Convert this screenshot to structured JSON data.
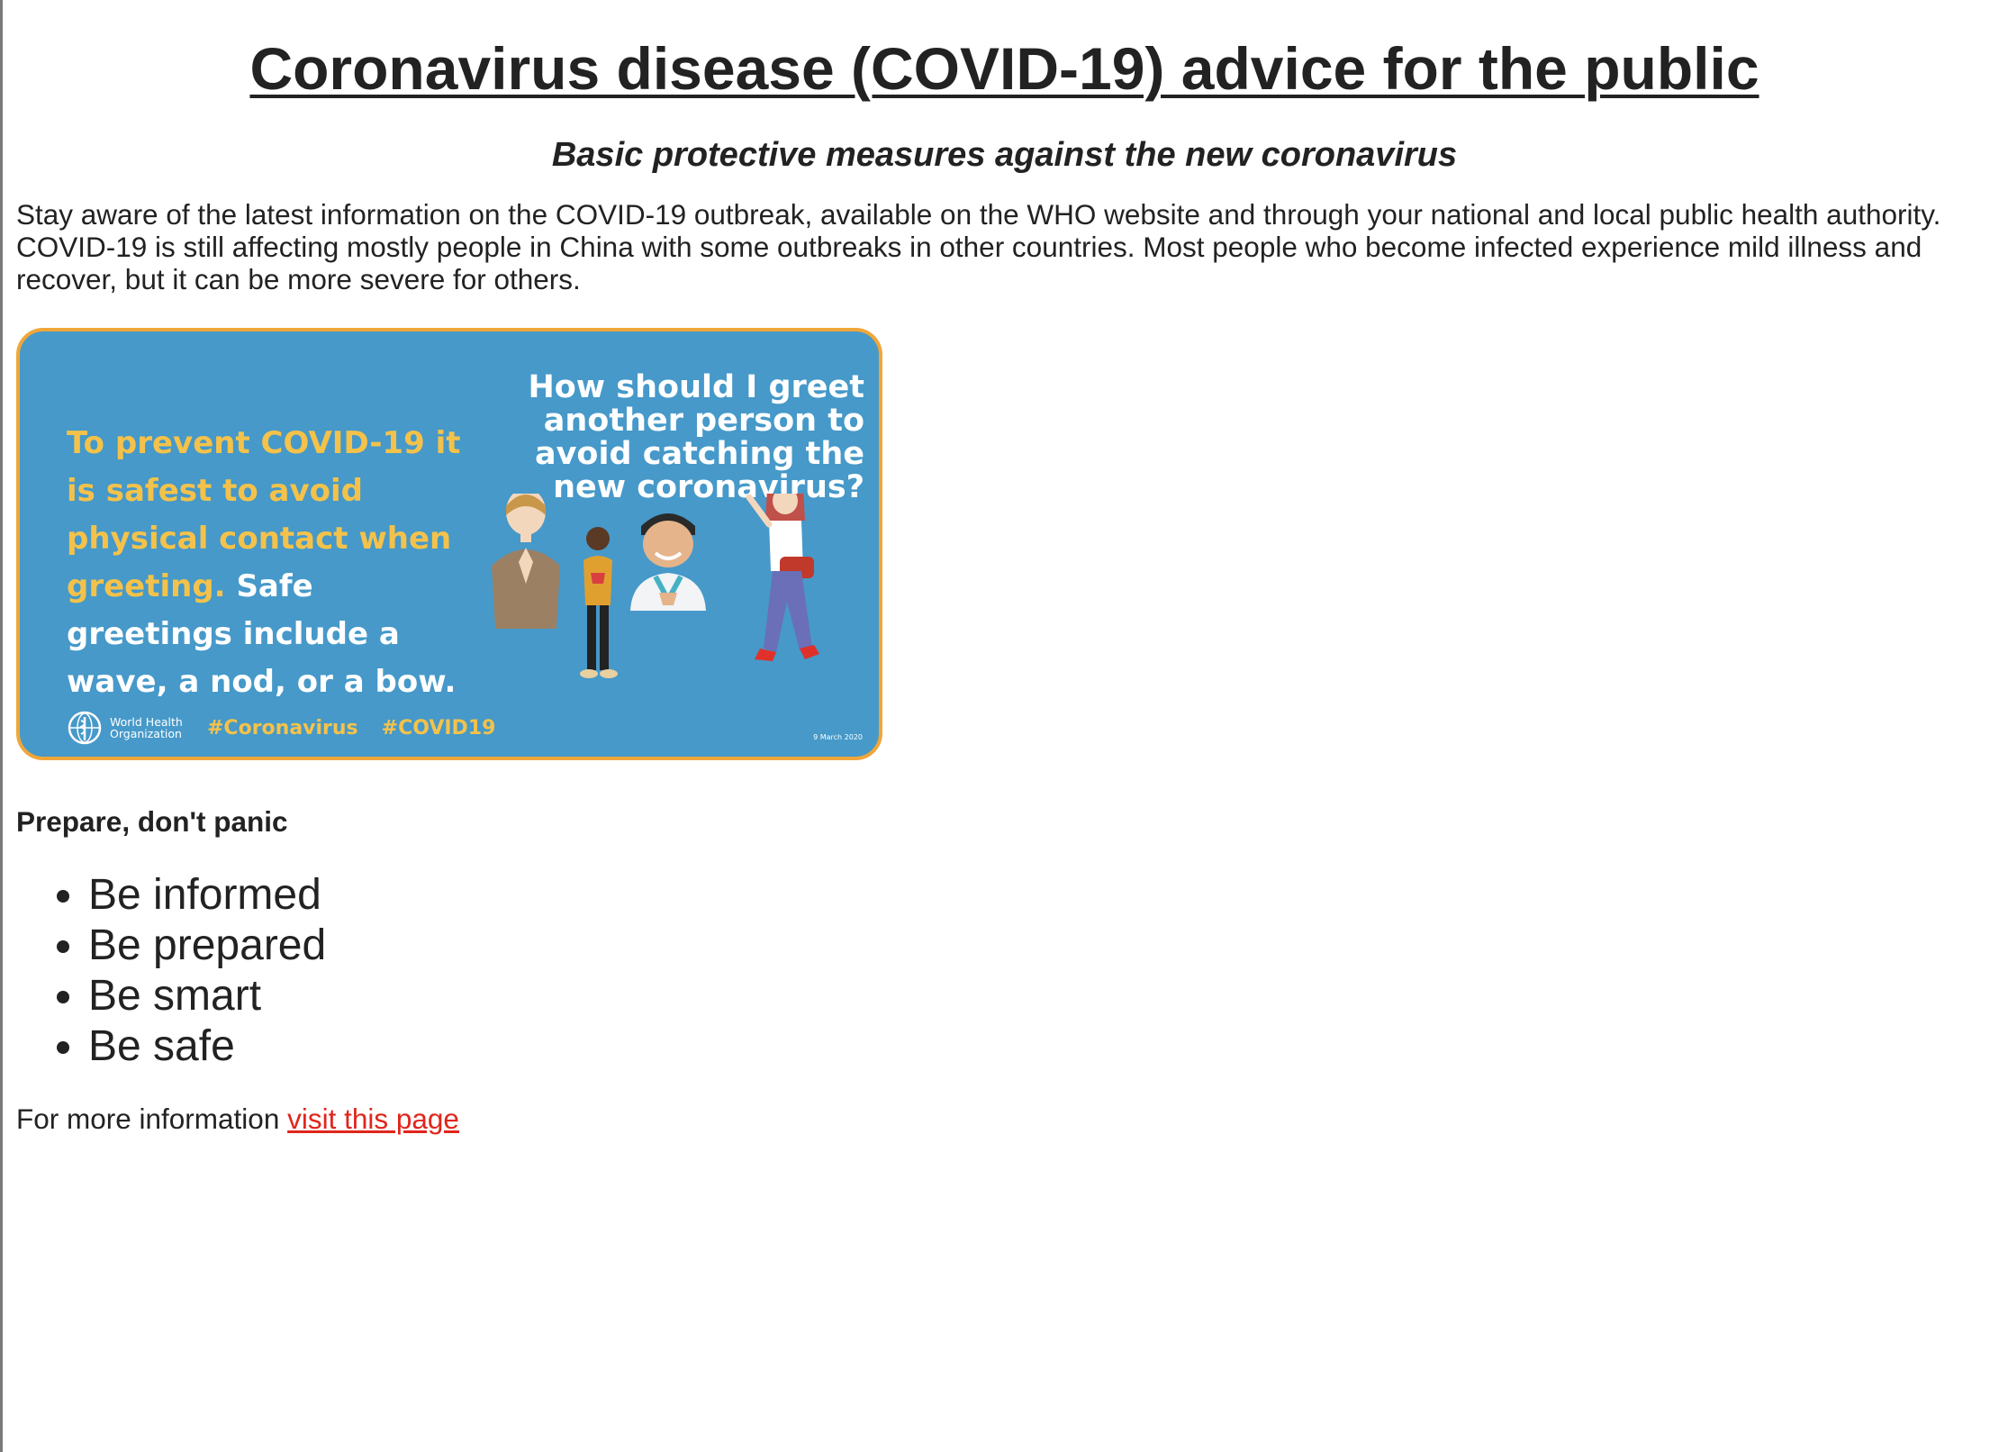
{
  "page": {
    "title": "Coronavirus disease (COVID-19) advice for the public",
    "subtitle": "Basic protective measures against the new coronavirus",
    "intro": "Stay aware of the latest information on the COVID-19 outbreak, available on the WHO website and through your national and local public health authority. COVID-19 is still affecting mostly people in China with some outbreaks in other countries. Most people who become infected experience mild illness and recover, but it can be more severe for others."
  },
  "banner": {
    "left_yellow": "To prevent COVID-19 it is safest to avoid physical contact when greeting.",
    "left_white": "Safe greetings include a wave, a nod, or a bow.",
    "question": "How should I greet another person to avoid catching the new coronavirus?",
    "org_name": "World Health Organization",
    "hashtags": [
      "#Coronavirus",
      "#COVID19"
    ],
    "date": "9 March 2020",
    "colors": {
      "background": "#4699c9",
      "border": "#efa63a",
      "accent_text": "#f4c24a"
    },
    "icons": [
      "who-emblem-icon",
      "person-bowing-icon",
      "person-hand-on-heart-icon",
      "doctor-icon",
      "person-waving-icon"
    ]
  },
  "section": {
    "heading": "Prepare, don't panic",
    "items": [
      "Be informed",
      "Be prepared",
      "Be smart",
      "Be safe"
    ]
  },
  "footer": {
    "text": "For more information ",
    "link_label": "visit this page",
    "link_color": "#e0251b"
  }
}
